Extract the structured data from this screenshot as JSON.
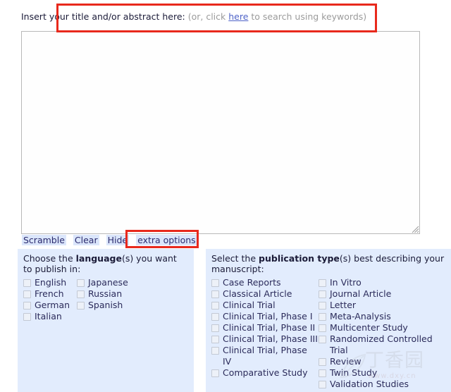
{
  "header": {
    "label": "Insert your title and/or abstract here:",
    "hint_before": " (or, click ",
    "link": "here",
    "hint_after": " to search using keywords)"
  },
  "abstract": {
    "value": "",
    "placeholder": ""
  },
  "toolbar": {
    "scramble_label": "Scramble",
    "clear_label": "Clear",
    "hide_label": "Hide",
    "extra_options_label": "extra options"
  },
  "language_panel": {
    "title_pre": "Choose the ",
    "title_bold": "language",
    "title_post": "(s) you want to publish in:",
    "column_1": [
      {
        "label": "English",
        "checked": false
      },
      {
        "label": "French",
        "checked": false
      },
      {
        "label": "German",
        "checked": false
      },
      {
        "label": "Italian",
        "checked": false
      }
    ],
    "column_2": [
      {
        "label": "Japanese",
        "checked": false
      },
      {
        "label": "Russian",
        "checked": false
      },
      {
        "label": "Spanish",
        "checked": false
      }
    ]
  },
  "pubtype_panel": {
    "title_pre": "Select the ",
    "title_bold": "publication type",
    "title_post": "(s) best describing your manuscript:",
    "column_1": [
      {
        "label": "Case Reports",
        "checked": false
      },
      {
        "label": "Classical Article",
        "checked": false
      },
      {
        "label": "Clinical Trial",
        "checked": false
      },
      {
        "label": "Clinical Trial, Phase I",
        "checked": false
      },
      {
        "label": "Clinical Trial, Phase II",
        "checked": false
      },
      {
        "label": "Clinical Trial, Phase III",
        "checked": false
      },
      {
        "label": "Clinical Trial, Phase IV",
        "checked": false
      },
      {
        "label": "Comparative Study",
        "checked": false
      }
    ],
    "column_2": [
      {
        "label": "In Vitro",
        "checked": false
      },
      {
        "label": "Journal Article",
        "checked": false
      },
      {
        "label": "Letter",
        "checked": false
      },
      {
        "label": "Meta-Analysis",
        "checked": false
      },
      {
        "label": "Multicenter Study",
        "checked": false
      },
      {
        "label": "Randomized Controlled Trial",
        "checked": false
      },
      {
        "label": "Review",
        "checked": false
      },
      {
        "label": "Twin Study",
        "checked": false
      },
      {
        "label": "Validation Studies",
        "checked": false
      }
    ]
  },
  "annotations": {
    "header_highlight": "#e8291c",
    "extra_options_highlight": "#e8291c"
  },
  "watermark": {
    "text": "丁香园",
    "url": "www.dxy.cn"
  },
  "colors": {
    "panel_background": "#e2ecfd",
    "button_background": "#dbe6fb",
    "link": "#4f63c8",
    "hint_text": "#9b9b9b",
    "annotation_red": "#e8291c"
  }
}
